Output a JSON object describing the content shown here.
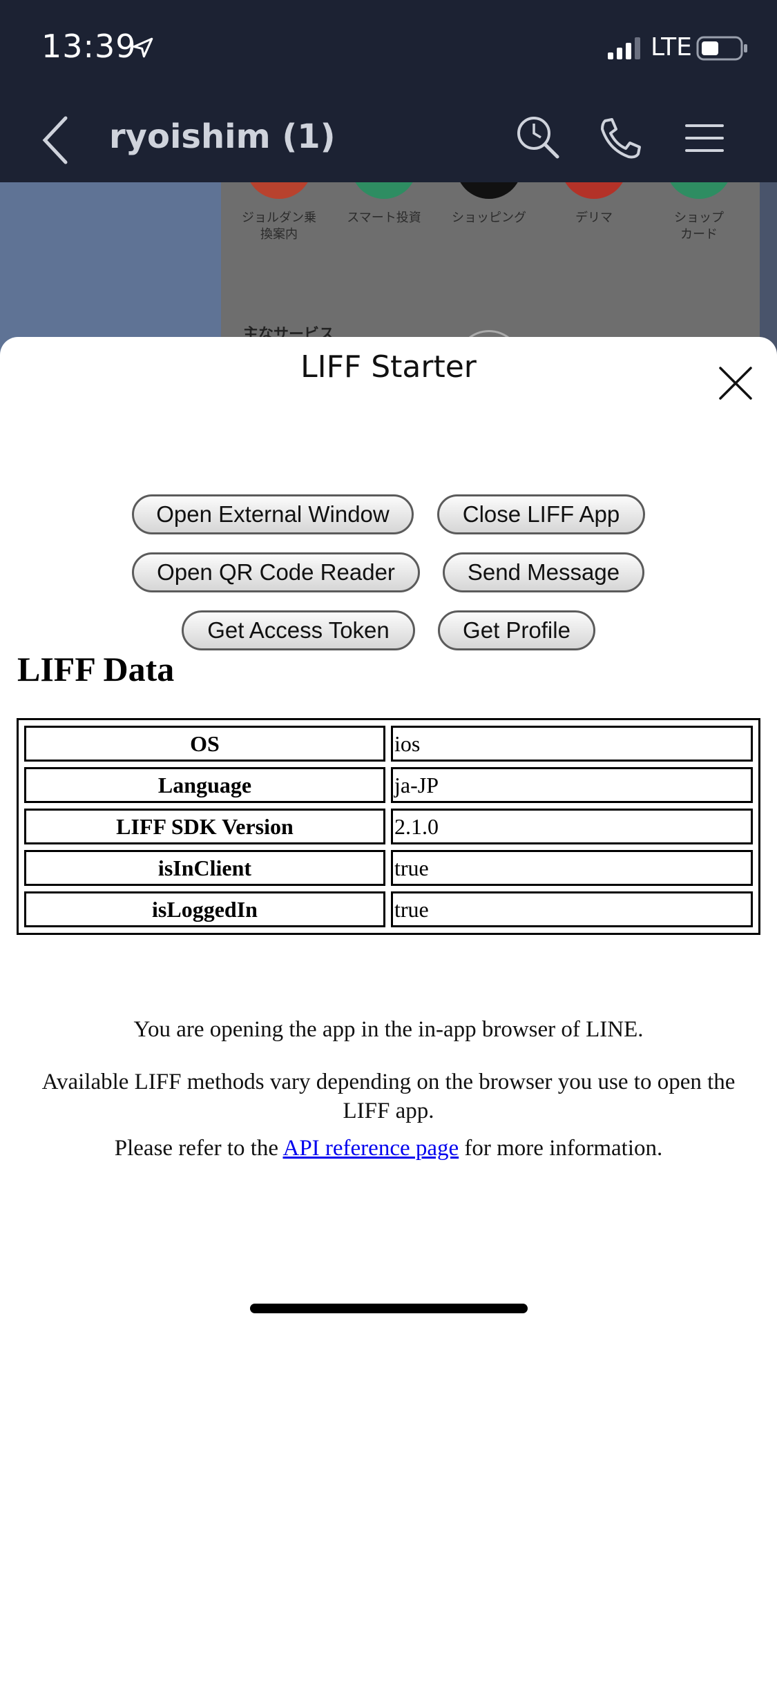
{
  "status_bar": {
    "time": "13:39",
    "network": "LTE"
  },
  "header": {
    "title": "ryoishim (1)"
  },
  "background": {
    "shortcuts": [
      {
        "label": "ジョルダン乗\n換案内",
        "color": "#c8402a"
      },
      {
        "label": "スマート投資",
        "color": "#2aa06a"
      },
      {
        "label": "ショッピング",
        "color": "#111111"
      },
      {
        "label": "デリマ",
        "color": "#c8302a"
      },
      {
        "label": "ショップ\nカード",
        "color": "#2aa06a"
      }
    ],
    "section_label": "主なサービス"
  },
  "liff": {
    "title": "LIFF Starter",
    "buttons": {
      "open_external": "Open External Window",
      "close_app": "Close LIFF App",
      "open_qr": "Open QR Code Reader",
      "send_message": "Send Message",
      "get_token": "Get Access Token",
      "get_profile": "Get Profile"
    },
    "data_heading": "LIFF Data",
    "table": [
      {
        "key": "OS",
        "value": "ios"
      },
      {
        "key": "Language",
        "value": "ja-JP"
      },
      {
        "key": "LIFF SDK Version",
        "value": "2.1.0"
      },
      {
        "key": "isInClient",
        "value": "true"
      },
      {
        "key": "isLoggedIn",
        "value": "true"
      }
    ],
    "info_line1": "You are opening the app in the in-app browser of LINE.",
    "info_line2": "Available LIFF methods vary depending on the browser you use to open the LIFF app.",
    "info_line3_prefix": "Please refer to the ",
    "info_link": "API reference page",
    "info_line3_suffix": " for more information."
  }
}
